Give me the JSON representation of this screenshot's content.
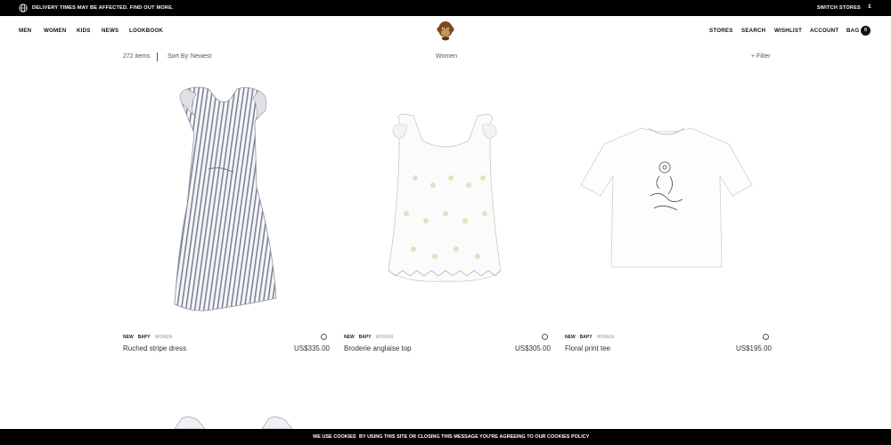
{
  "topbar": {
    "notice": "DELIVERY TIMES MAY BE AFFECTED. FIND OUT MORE.",
    "switch_stores": "SWITCH STORES",
    "currency": "£"
  },
  "nav": {
    "left": [
      "MEN",
      "WOMEN",
      "KIDS",
      "NEWS",
      "LOOKBOOK"
    ],
    "right": [
      "STORES",
      "SEARCH",
      "WISHLIST",
      "ACCOUNT",
      "BAG"
    ],
    "bag_count": "0"
  },
  "subbar": {
    "count": "272 items",
    "sort_label": "Sort By:",
    "sort_value": "Newest",
    "category": "Women",
    "filter": "+ Filter"
  },
  "products": [
    {
      "tags": [
        "NEW",
        "BAPY",
        "WOMEN"
      ],
      "name": "Ruched stripe dress",
      "price": "US$335.00"
    },
    {
      "tags": [
        "NEW",
        "BAPY",
        "WOMEN"
      ],
      "name": "Broderie anglaise top",
      "price": "US$305.00"
    },
    {
      "tags": [
        "NEW",
        "BAPY",
        "WOMEN"
      ],
      "name": "Floral print tee",
      "price": "US$195.00"
    }
  ],
  "cookie": {
    "label": "WE USE COOKIES",
    "message": "BY USING THIS SITE OR CLOSING THIS MESSAGE YOU'RE AGREEING TO OUR COOKIES POLICY"
  },
  "colors": {
    "bar": "#000000",
    "text": "#222222",
    "muted_tag": "#b7b7b7"
  }
}
